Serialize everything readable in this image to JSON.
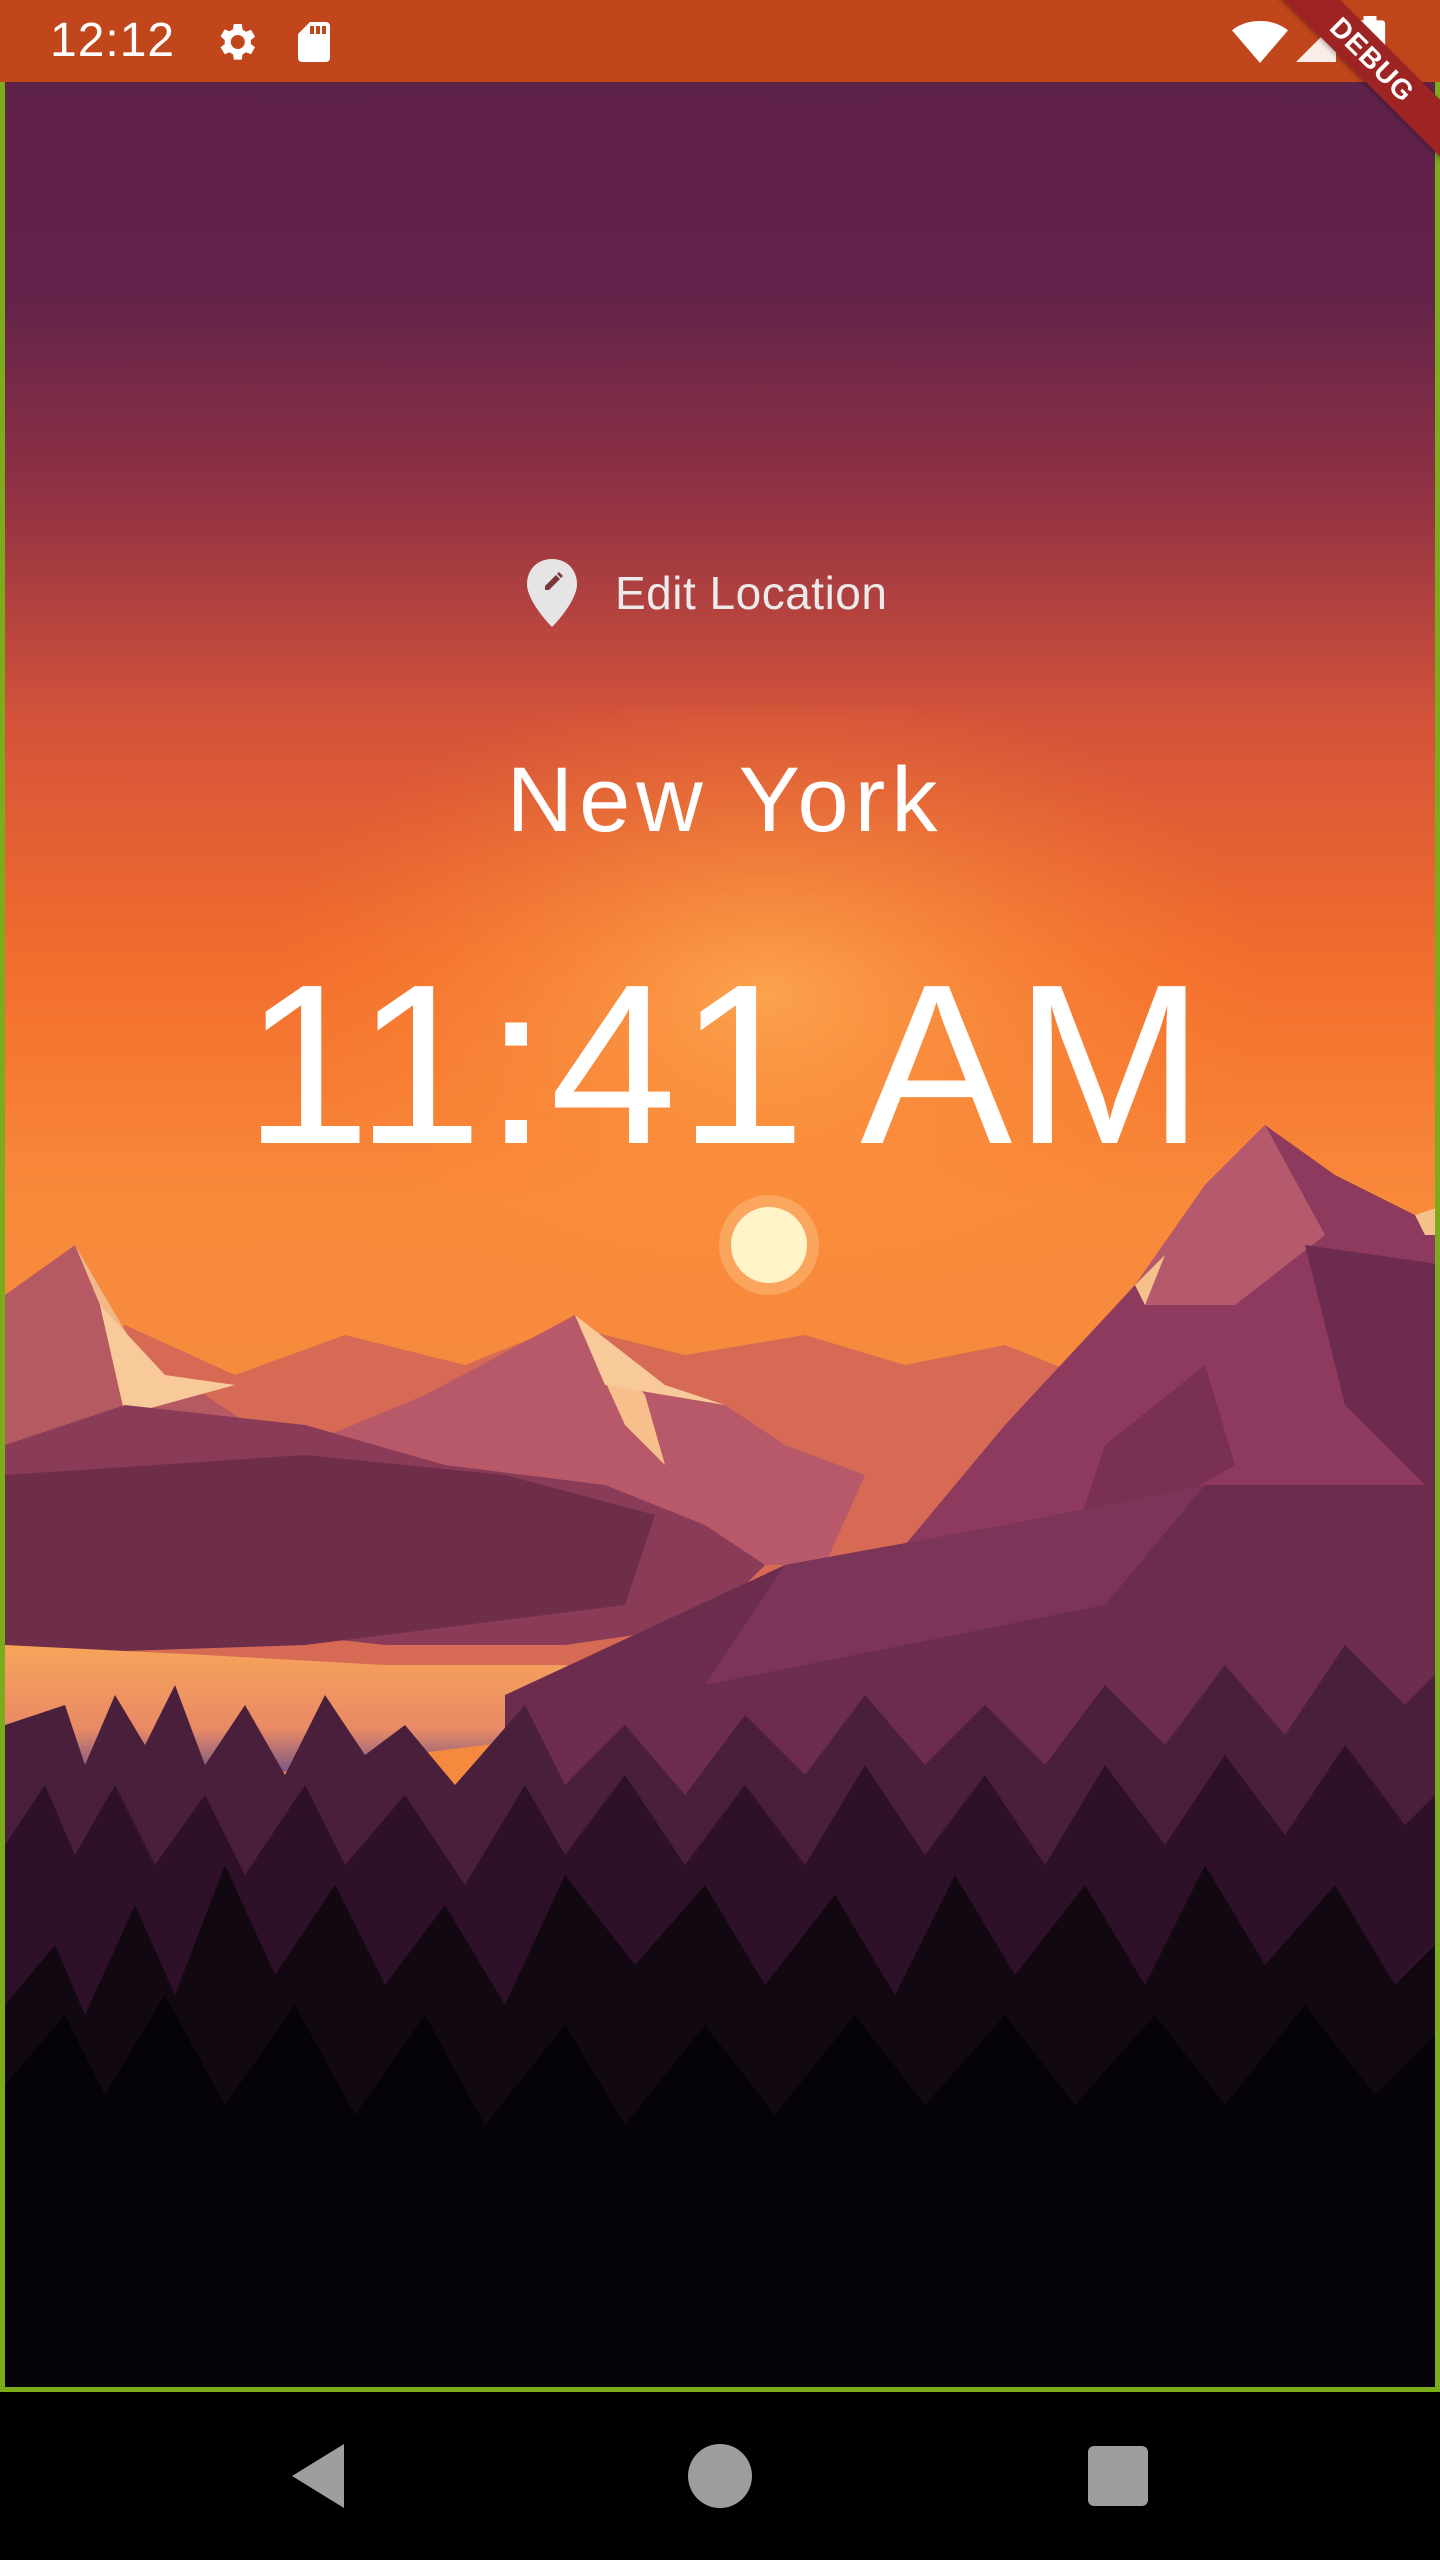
{
  "status_bar": {
    "time": "12:12",
    "icons": [
      "settings-icon",
      "sd-card-icon",
      "wifi-icon",
      "signal-icon",
      "battery-icon"
    ],
    "background": "#c1461c"
  },
  "debug_banner": "DEBUG",
  "location": {
    "edit_label": "Edit Location",
    "edit_icon": "edit-location-icon",
    "name": "New York",
    "time": "11:41 AM"
  },
  "nav_bar": {
    "buttons": [
      "back-icon",
      "home-icon",
      "recents-icon"
    ]
  },
  "colors": {
    "frame_border": "#7cab1c",
    "sky_top": "#5e2149",
    "sky_mid": "#f06a2a",
    "text": "#ffffff"
  }
}
